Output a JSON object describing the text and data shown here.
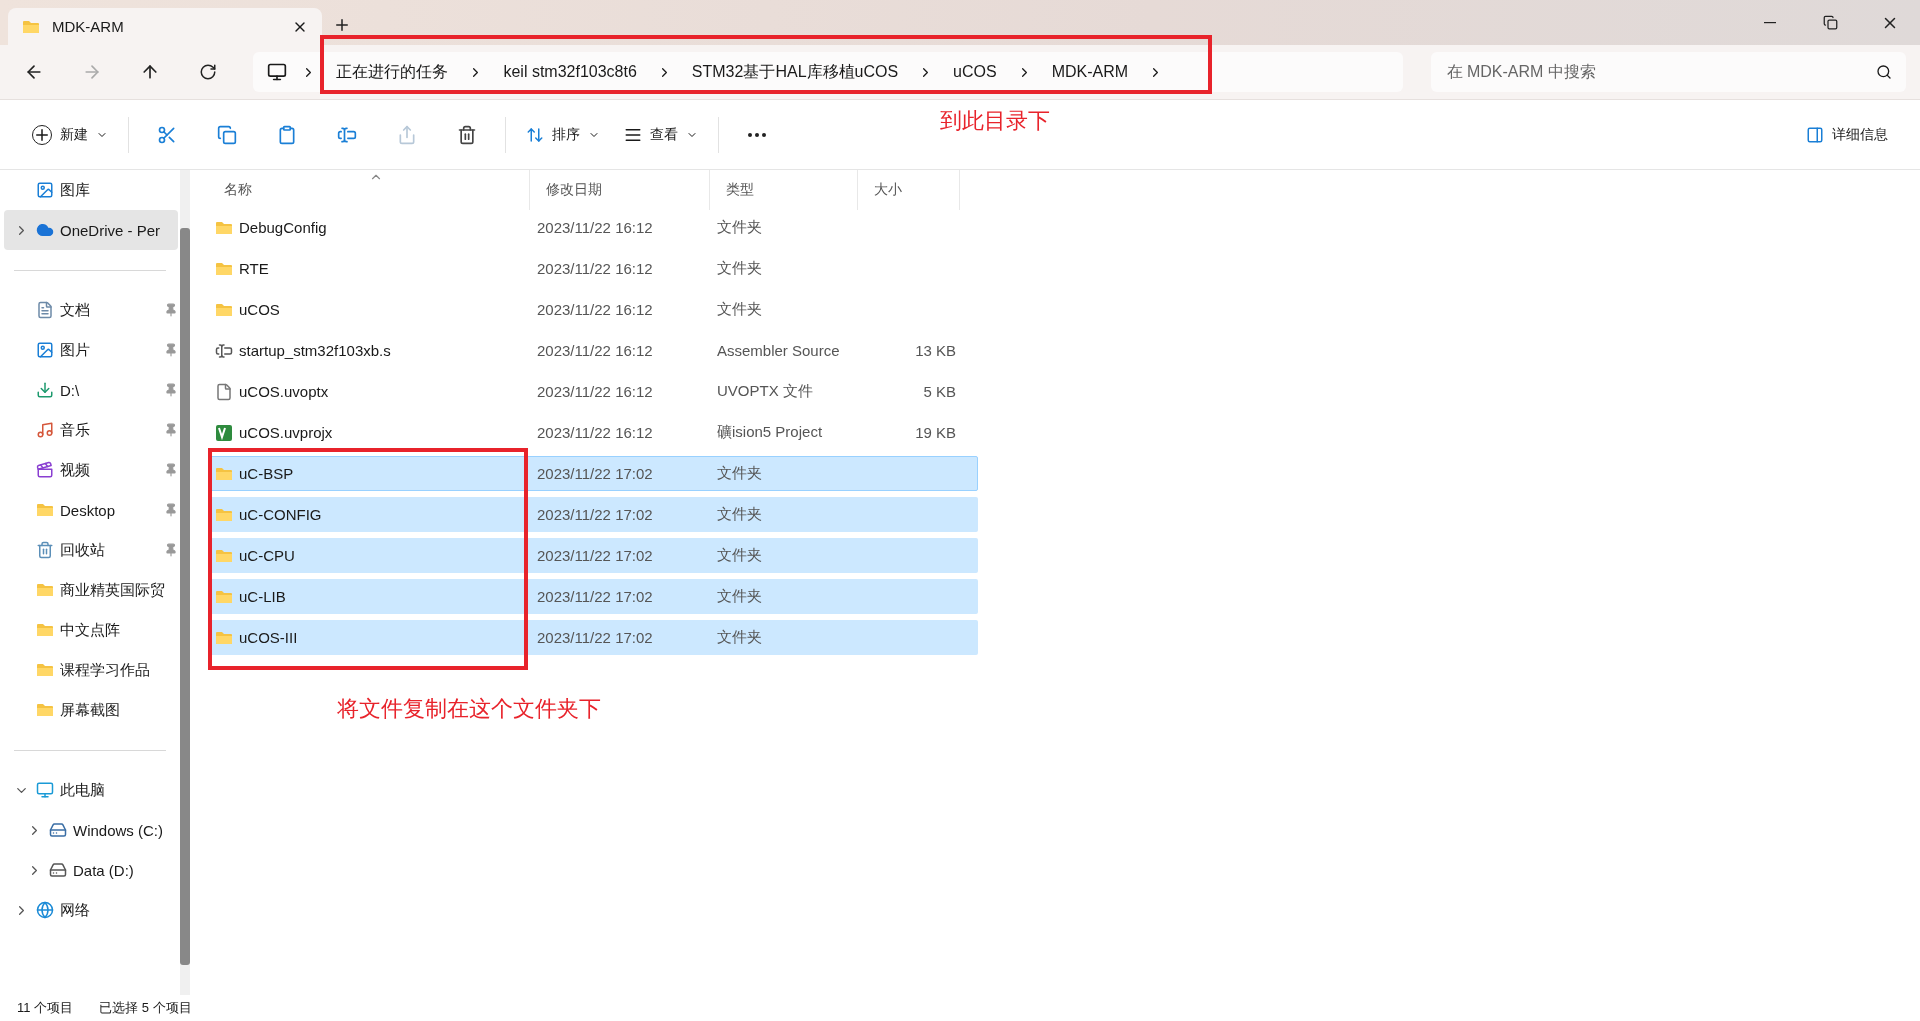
{
  "tab": {
    "title": "MDK-ARM"
  },
  "breadcrumbs": [
    "正在进行的任务",
    "keil stm32f103c8t6",
    "STM32基于HAL库移植uCOS",
    "uCOS",
    "MDK-ARM"
  ],
  "search": {
    "placeholder": "在 MDK-ARM 中搜索"
  },
  "toolbar": {
    "new": "新建",
    "actions": [
      {
        "kind": "cut",
        "disabled": false
      },
      {
        "kind": "copy",
        "disabled": false
      },
      {
        "kind": "paste",
        "disabled": false
      },
      {
        "kind": "rename",
        "disabled": false
      },
      {
        "kind": "share",
        "disabled": true
      },
      {
        "kind": "delete",
        "disabled": false
      }
    ],
    "sort": "排序",
    "view": "查看",
    "details": "详细信息"
  },
  "sidebar": {
    "groups": [
      [
        {
          "label": "图库",
          "kind": "gallery",
          "selected": false
        },
        {
          "label": "OneDrive - Per",
          "kind": "cloud",
          "expanded": false,
          "selected": true
        }
      ],
      [
        {
          "label": "文档",
          "kind": "docs",
          "pinned": true,
          "selected": false
        },
        {
          "label": "图片",
          "kind": "gallery",
          "pinned": true,
          "selected": false
        },
        {
          "label": "D:\\",
          "kind": "download",
          "pinned": true,
          "selected": false
        },
        {
          "label": "音乐",
          "kind": "music",
          "pinned": true,
          "selected": false
        },
        {
          "label": "视频",
          "kind": "video",
          "pinned": true,
          "selected": false
        },
        {
          "label": "Desktop",
          "kind": "folder",
          "pinned": true,
          "selected": false
        },
        {
          "label": "回收站",
          "kind": "recycle",
          "pinned": true,
          "selected": false
        },
        {
          "label": "商业精英国际贸",
          "kind": "folder",
          "pinned": false,
          "selected": false
        },
        {
          "label": "中文点阵",
          "kind": "folder",
          "pinned": false,
          "selected": false
        },
        {
          "label": "课程学习作品",
          "kind": "folder",
          "pinned": false,
          "selected": false
        },
        {
          "label": "屏幕截图",
          "kind": "folder",
          "pinned": false,
          "selected": false
        }
      ],
      [
        {
          "label": "此电脑",
          "kind": "pc",
          "expanded": true,
          "selected": false,
          "children": [
            {
              "label": "Windows (C:)",
              "kind": "windrive",
              "expanded": false,
              "selected": false
            },
            {
              "label": "Data (D:)",
              "kind": "drive",
              "expanded": false,
              "selected": false
            }
          ]
        },
        {
          "label": "网络",
          "kind": "network",
          "expanded": false,
          "selected": false
        }
      ]
    ]
  },
  "columns": [
    {
      "label": "名称",
      "sorted": true
    },
    {
      "label": "修改日期",
      "sorted": false
    },
    {
      "label": "类型",
      "sorted": false
    },
    {
      "label": "大小",
      "sorted": false
    }
  ],
  "files": [
    {
      "name": "DebugConfig",
      "kind": "folder",
      "date": "2023/11/22 16:12",
      "type": "文件夹",
      "selected": false
    },
    {
      "name": "RTE",
      "kind": "folder",
      "date": "2023/11/22 16:12",
      "type": "文件夹",
      "selected": false
    },
    {
      "name": "uCOS",
      "kind": "folder",
      "date": "2023/11/22 16:12",
      "type": "文件夹",
      "selected": false
    },
    {
      "name": "startup_stm32f103xb.s",
      "kind": "asm",
      "date": "2023/11/22 16:12",
      "type": "Assembler Source",
      "size": "13 KB",
      "selected": false
    },
    {
      "name": "uCOS.uvoptx",
      "kind": "file",
      "date": "2023/11/22 16:12",
      "type": "UVOPTX 文件",
      "size": "5 KB",
      "selected": false
    },
    {
      "name": "uCOS.uvprojx",
      "kind": "project",
      "date": "2023/11/22 16:12",
      "type": "礦ision5 Project",
      "size": "19 KB",
      "selected": false
    },
    {
      "name": "uC-BSP",
      "kind": "folder",
      "date": "2023/11/22 17:02",
      "type": "文件夹",
      "selected": true,
      "focused": true
    },
    {
      "name": "uC-CONFIG",
      "kind": "folder",
      "date": "2023/11/22 17:02",
      "type": "文件夹",
      "selected": true
    },
    {
      "name": "uC-CPU",
      "kind": "folder",
      "date": "2023/11/22 17:02",
      "type": "文件夹",
      "selected": true
    },
    {
      "name": "uC-LIB",
      "kind": "folder",
      "date": "2023/11/22 17:02",
      "type": "文件夹",
      "selected": true
    },
    {
      "name": "uCOS-III",
      "kind": "folder",
      "date": "2023/11/22 17:02",
      "type": "文件夹",
      "selected": true
    }
  ],
  "status_bar": {
    "count": "11 个项目",
    "selection": "已选择 5 个项目"
  },
  "annotations": {
    "address_note": "到此目录下",
    "files_note": "将文件复制在这个文件夹下"
  }
}
